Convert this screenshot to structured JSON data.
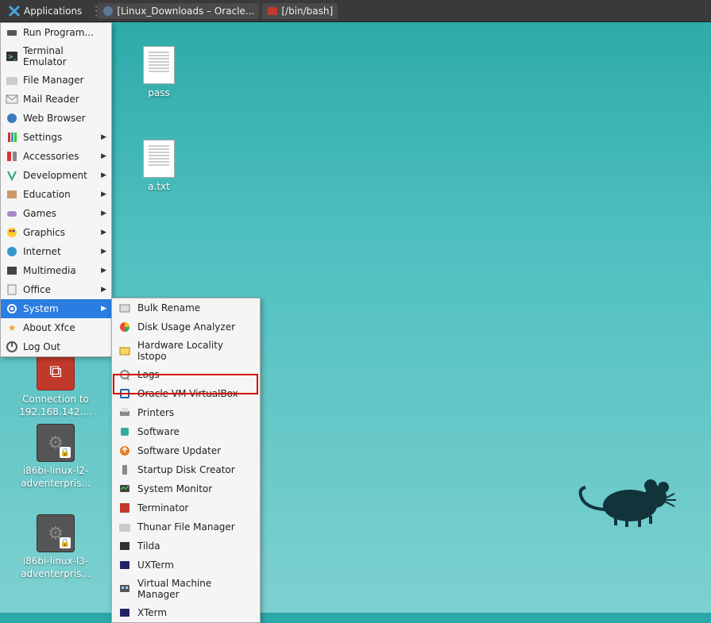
{
  "taskbar": {
    "applications_label": "Applications",
    "window1_label": "[Linux_Downloads – Oracle...",
    "window2_label": "[/bin/bash]"
  },
  "desktop_icons": {
    "pass": "pass",
    "atxt": "a.txt",
    "conn": "Connection to 192.168.142....",
    "l2": "i86bi-linux-l2-adventerpris...",
    "l3": "i86bi-linux-l3-adventerpris..."
  },
  "menu": {
    "run_program": "Run Program...",
    "terminal": "Terminal Emulator",
    "file_manager": "File Manager",
    "mail": "Mail Reader",
    "browser": "Web Browser",
    "settings": "Settings",
    "accessories": "Accessories",
    "development": "Development",
    "education": "Education",
    "games": "Games",
    "graphics": "Graphics",
    "internet": "Internet",
    "multimedia": "Multimedia",
    "office": "Office",
    "system": "System",
    "about": "About Xfce",
    "logout": "Log Out"
  },
  "submenu": {
    "bulk_rename": "Bulk Rename",
    "disk_usage": "Disk Usage Analyzer",
    "hwloc": "Hardware Locality lstopo",
    "logs": "Logs",
    "vbox": "Oracle VM VirtualBox",
    "printers": "Printers",
    "software": "Software",
    "updater": "Software Updater",
    "startup_disk": "Startup Disk Creator",
    "sysmon": "System Monitor",
    "terminator": "Terminator",
    "thunar": "Thunar File Manager",
    "tilda": "Tilda",
    "uxterm": "UXTerm",
    "vmm": "Virtual Machine Manager",
    "xterm": "XTerm"
  }
}
